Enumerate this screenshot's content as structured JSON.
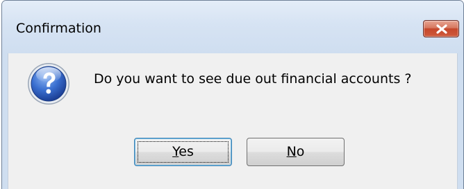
{
  "window": {
    "title": "Confirmation"
  },
  "message": {
    "text": "Do you want to see due out financial accounts ?",
    "icon": "question-icon"
  },
  "buttons": {
    "yes": {
      "mnemonic": "Y",
      "rest": "es"
    },
    "no": {
      "mnemonic": "N",
      "rest": "o"
    }
  },
  "colors": {
    "titlebar": "#d6e3f3",
    "close_button": "#c5472b",
    "icon": "#2f5fbf",
    "focus_border": "#3c7fb1"
  }
}
